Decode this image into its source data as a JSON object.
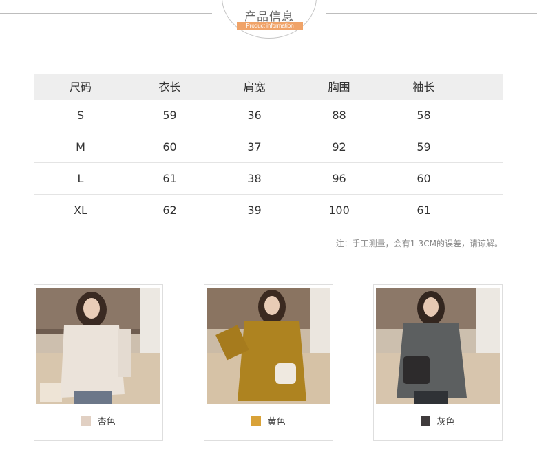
{
  "header": {
    "title": "产品信息",
    "subtitle": "Product information"
  },
  "size_table": {
    "headers": [
      "尺码",
      "衣长",
      "肩宽",
      "胸围",
      "袖长"
    ],
    "rows": [
      [
        "S",
        "59",
        "36",
        "88",
        "58"
      ],
      [
        "M",
        "60",
        "37",
        "92",
        "59"
      ],
      [
        "L",
        "61",
        "38",
        "96",
        "60"
      ],
      [
        "XL",
        "62",
        "39",
        "100",
        "61"
      ]
    ],
    "note": "注：手工测量，会有1-3CM的误差，请谅解。"
  },
  "colors": [
    {
      "name": "杏色",
      "swatch": "#e1d0c3",
      "sweater": "#ebe3da"
    },
    {
      "name": "黄色",
      "swatch": "#d9a238",
      "sweater": "#ae8320"
    },
    {
      "name": "灰色",
      "swatch": "#3f3b3c",
      "sweater": "#5c5f60"
    }
  ]
}
